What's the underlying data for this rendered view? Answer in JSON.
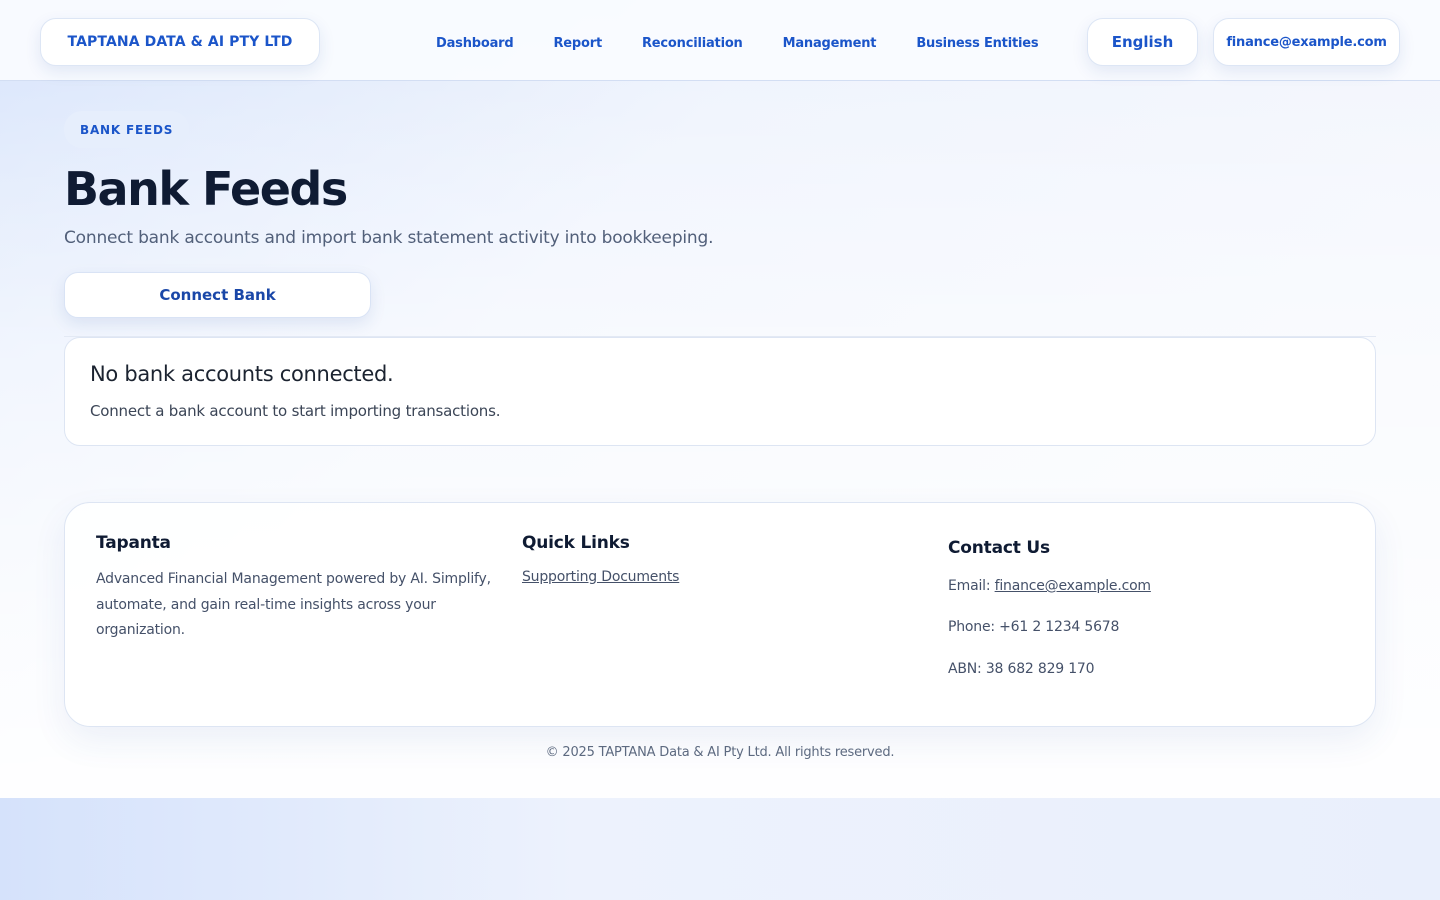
{
  "header": {
    "brand": "TAPTANA DATA & AI PTY LTD",
    "nav": [
      "Dashboard",
      "Report",
      "Reconciliation",
      "Management",
      "Business Entities"
    ],
    "language": "English",
    "user_email": "finance@example.com"
  },
  "main": {
    "eyebrow": "BANK FEEDS",
    "title": "Bank Feeds",
    "subtitle": "Connect bank accounts and import bank statement activity into bookkeeping.",
    "connect_button": "Connect Bank",
    "empty_state": {
      "title": "No bank accounts connected.",
      "description": "Connect a bank account to start importing transactions."
    }
  },
  "footer": {
    "about": {
      "heading": "Tapanta",
      "text": "Advanced Financial Management powered by AI. Simplify, automate, and gain real-time insights across your organization."
    },
    "quick_links": {
      "heading": "Quick Links",
      "links": [
        "Supporting Documents"
      ]
    },
    "contact": {
      "heading": "Contact Us",
      "email_label": "Email: ",
      "email": "finance@example.com",
      "phone": "Phone: +61 2 1234 5678",
      "abn": "ABN: 38 682 829 170"
    },
    "copyright": "© 2025 TAPTANA Data & AI Pty Ltd. All rights reserved."
  },
  "colors": {
    "accent": "#1b55c9",
    "heading": "#0f1b33",
    "muted_text": "#52607a",
    "background_tint": "#d6e3fb"
  }
}
